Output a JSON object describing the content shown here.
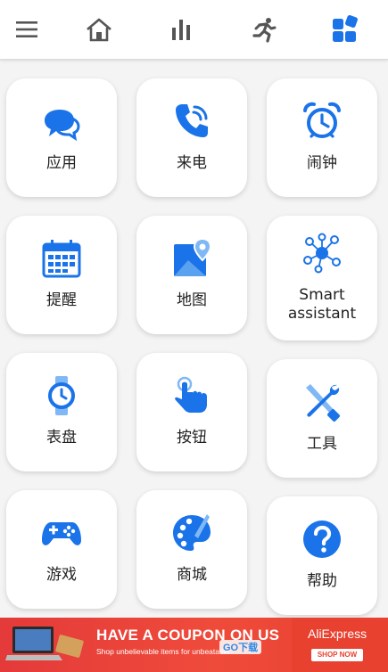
{
  "top_nav": {
    "items": [
      {
        "icon": "menu-icon"
      },
      {
        "icon": "home-icon"
      },
      {
        "icon": "bar-chart-icon"
      },
      {
        "icon": "running-icon"
      },
      {
        "icon": "apps-grid-icon"
      }
    ]
  },
  "tiles": [
    {
      "icon": "message-icon",
      "label": "应用"
    },
    {
      "icon": "phone-icon",
      "label": "来电"
    },
    {
      "icon": "alarm-clock-icon",
      "label": "闹钟"
    },
    {
      "icon": "calendar-icon",
      "label": "提醒"
    },
    {
      "icon": "map-icon",
      "label": "地图"
    },
    {
      "icon": "smart-assistant-icon",
      "label": "Smart assistant"
    },
    {
      "icon": "watch-icon",
      "label": "表盘"
    },
    {
      "icon": "press-button-icon",
      "label": "按钮"
    },
    {
      "icon": "tools-icon",
      "label": "工具"
    },
    {
      "icon": "gamepad-icon",
      "label": "游戏"
    },
    {
      "icon": "palette-icon",
      "label": "商城"
    },
    {
      "icon": "help-icon",
      "label": "帮助"
    }
  ],
  "ad": {
    "headline": "HAVE A COUPON ON US",
    "subtext": "Shop unbelievable items for unbeatable",
    "brand": "AliExpress",
    "cta": "SHOP NOW",
    "watermark": "GO下载",
    "background": "#e8412f"
  },
  "colors": {
    "accent": "#1a73e8",
    "icon_gray": "#555555"
  }
}
